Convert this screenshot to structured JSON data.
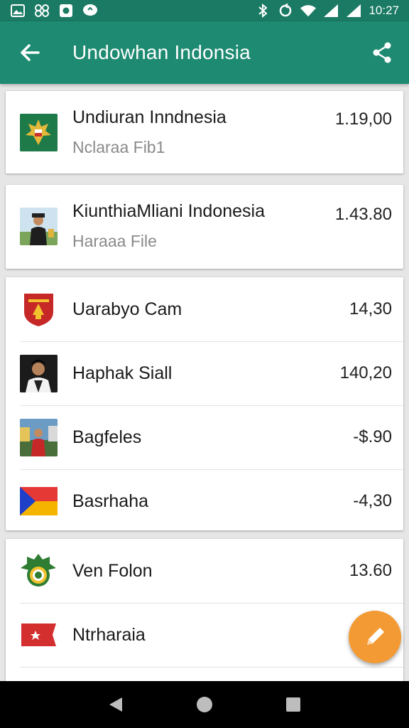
{
  "status_bar": {
    "time": "10:27",
    "left_icons": [
      "image-icon",
      "grid-icon",
      "camera-icon",
      "chat-icon"
    ],
    "right_icons": [
      "bluetooth-icon",
      "sync-icon",
      "wifi-icon",
      "signal-icon",
      "signal-icon"
    ]
  },
  "app_bar": {
    "title": "Undowhan Indonsia",
    "back_icon": "arrow-left-icon",
    "share_icon": "share-icon",
    "color": "#1e8a71"
  },
  "cards": [
    {
      "rows": [
        {
          "title": "Undiuran Inndnesia",
          "subtitle": "Nclaraa Fib1",
          "value": "1.19,00",
          "thumb": "emblem-icon"
        }
      ]
    },
    {
      "rows": [
        {
          "title": "KiunthiaMliani Indonesia",
          "subtitle": "Haraaa File",
          "value": "1.43.80",
          "thumb": "person-photo-icon"
        }
      ]
    },
    {
      "rows": [
        {
          "title": "Uarabyo Cam",
          "value": "14,30",
          "thumb": "red-crest-icon"
        },
        {
          "title": "Haphak Siall",
          "value": "140,20",
          "thumb": "portrait-photo-icon"
        },
        {
          "title": "Bagfeles",
          "value": "-$.90",
          "thumb": "street-photo-icon"
        },
        {
          "title": "Basrhaha",
          "value": "-4,30",
          "thumb": "flag-icon"
        }
      ]
    },
    {
      "rows": [
        {
          "title": "Ven Folon",
          "value": "13.60",
          "thumb": "green-emblem-icon"
        },
        {
          "title": "Ntrharaia",
          "value": "",
          "thumb": "red-flag-icon"
        }
      ]
    }
  ],
  "fab": {
    "icon": "pencil-icon",
    "color": "#f39a34"
  },
  "nav_bar": {
    "icons": [
      "back-triangle-icon",
      "home-circle-icon",
      "recents-square-icon"
    ]
  }
}
